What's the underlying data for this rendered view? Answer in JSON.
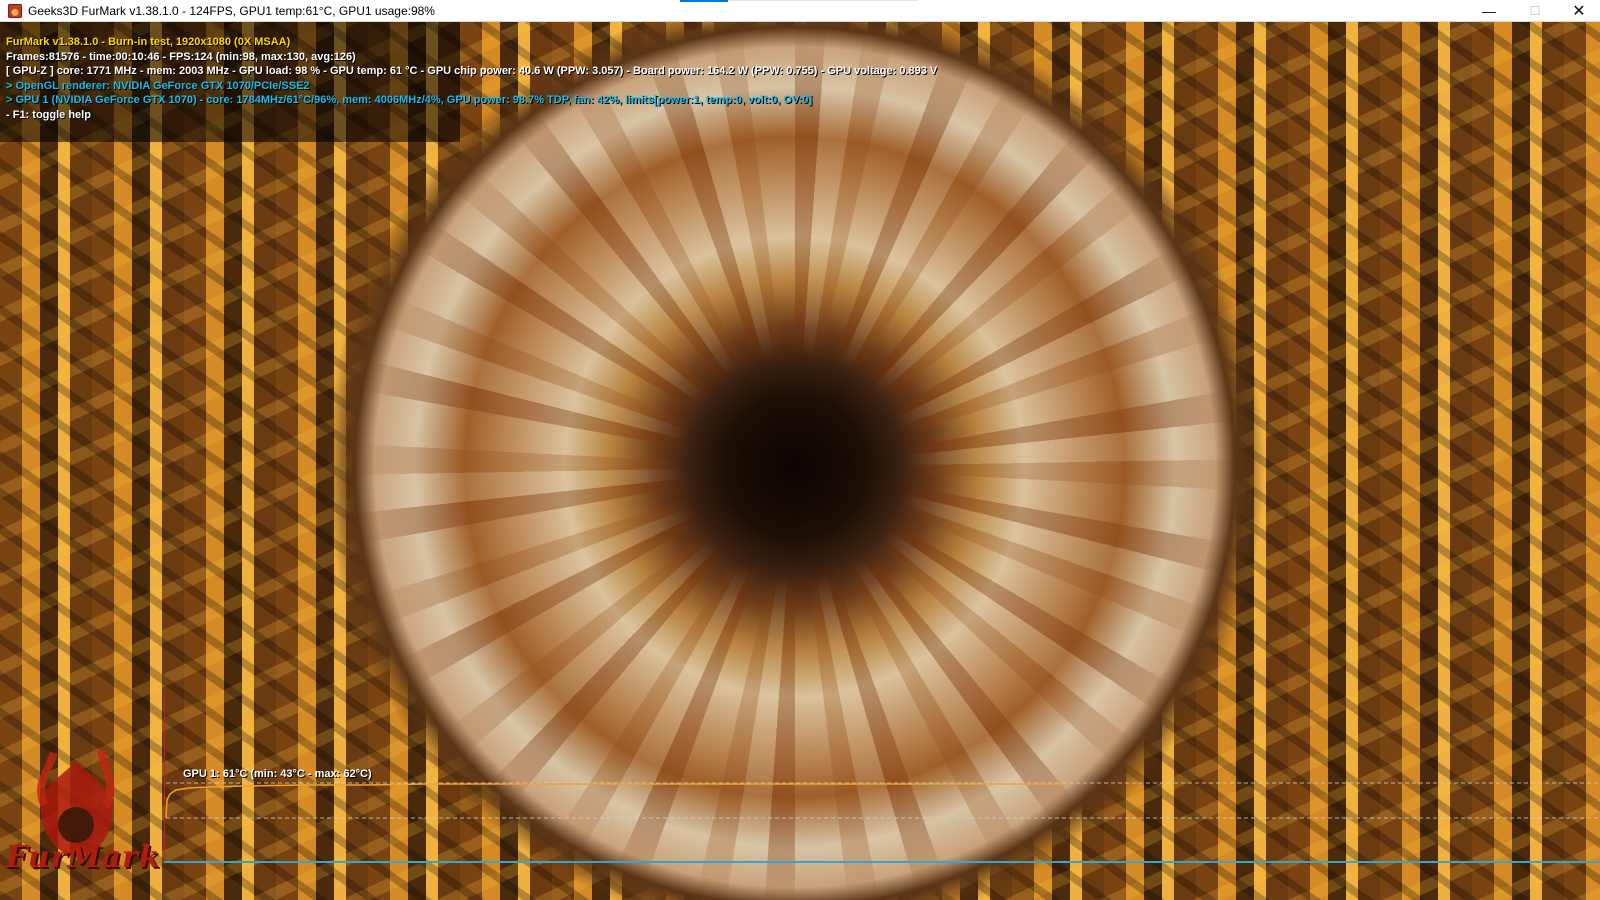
{
  "window": {
    "title": "Geeks3D FurMark v1.38.1.0 - 124FPS, GPU1 temp:61°C, GPU1 usage:98%",
    "icon": "furmark-app-icon",
    "controls": {
      "minimize": "—",
      "maximize": "☐",
      "close": "✕"
    }
  },
  "hud": {
    "line1": "FurMark v1.38.1.0 - Burn-in test, 1920x1080 (0X MSAA)",
    "line2": "Frames:81576 - time:00:10:46 - FPS:124 (min:98, max:130, avg:126)",
    "line3": "[ GPU-Z ] core: 1771 MHz - mem: 2003 MHz - GPU load: 98 % - GPU temp: 61 °C - GPU chip power: 40.6 W (PPW: 3.057) - Board power: 164.2 W (PPW: 0.755) - GPU voltage: 0.893 V",
    "line4": "> OpenGL renderer: NVIDIA GeForce GTX 1070/PCIe/SSE2",
    "line5": "> GPU 1 (NVIDIA GeForce GTX 1070) - core: 1784MHz/61°C/96%, mem: 4006MHz/4%, GPU power: 98.7% TDP, fan: 42%, limits[power:1, temp:0, volt:0, OV:0]",
    "line6": "- F1: toggle help"
  },
  "logo": {
    "text": "FurMark"
  },
  "graph": {
    "label": "GPU 1: 61°C (min: 43°C - max: 62°C)",
    "current_c": 61,
    "min_c": 43,
    "max_c": 62
  },
  "colors": {
    "hud_yellow": "#ffd800",
    "hud_cyan": "#21b9e6",
    "graph_line": "#f0a030",
    "graph_axis_red": "#d02010",
    "graph_axis_blue": "#2aa8d8"
  }
}
